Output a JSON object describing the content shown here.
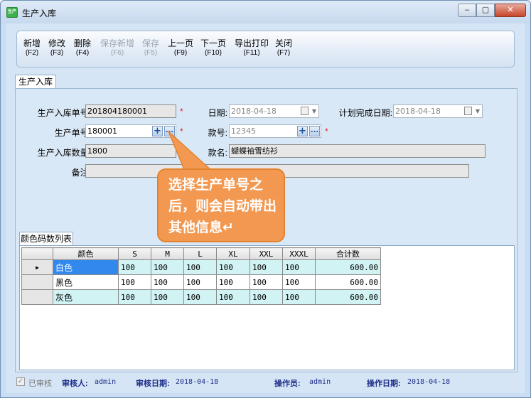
{
  "window": {
    "icon_text": "生产",
    "title": "生产入库",
    "controls": {
      "minimize": "–",
      "maximize": "▢",
      "close": "✕"
    }
  },
  "toolbar": [
    {
      "label": "新增",
      "key": "(F2)",
      "enabled": true
    },
    {
      "label": "修改",
      "key": "(F3)",
      "enabled": true
    },
    {
      "label": "删除",
      "key": "(F4)",
      "enabled": true
    },
    {
      "label": "保存新增",
      "key": "(F6)",
      "enabled": false
    },
    {
      "label": "保存",
      "key": "(F5)",
      "enabled": false
    },
    {
      "label": "上一页",
      "key": "(F9)",
      "enabled": true
    },
    {
      "label": "下一页",
      "key": "(F10)",
      "enabled": true
    },
    {
      "label": "导出打印",
      "key": "(F11)",
      "enabled": true
    },
    {
      "label": "关闭",
      "key": "(F7)",
      "enabled": true
    }
  ],
  "main_tab": "生产入库",
  "form": {
    "inbound_no_label": "生产入库单号:",
    "inbound_no": "201804180001",
    "date_label": "日期:",
    "date": "2018-04-18",
    "plan_done_label": "计划完成日期:",
    "plan_done": "2018-04-18",
    "prod_no_label": "生产单号:",
    "prod_no": "180001",
    "style_no_label": "款号:",
    "style_no": "12345",
    "qty_label": "生产入库数量:",
    "qty": "1800",
    "style_name_label": "款名:",
    "style_name": "蝴蝶袖雪纺衫",
    "remark_label": "备注:",
    "remark": "",
    "required_mark": "*",
    "add_symbol": "+",
    "browse_symbol": "..."
  },
  "callout": {
    "text": "选择生产单号之后，则会自动带出其他信息↵"
  },
  "sub_tab": "颜色码数列表",
  "grid": {
    "headers": [
      "颜色",
      "S",
      "M",
      "L",
      "XL",
      "XXL",
      "XXXL",
      "合计数"
    ],
    "current_row_marker": "▶",
    "rows": [
      {
        "color": "白色",
        "s": "100",
        "m": "100",
        "l": "100",
        "xl": "100",
        "xxl": "100",
        "xxxl": "100",
        "total": "600.00"
      },
      {
        "color": "黑色",
        "s": "100",
        "m": "100",
        "l": "100",
        "xl": "100",
        "xxl": "100",
        "xxxl": "100",
        "total": "600.00"
      },
      {
        "color": "灰色",
        "s": "100",
        "m": "100",
        "l": "100",
        "xl": "100",
        "xxl": "100",
        "xxxl": "100",
        "total": "600.00"
      }
    ]
  },
  "status": {
    "approved_label": "已审核",
    "approved_check": "✓",
    "reviewer_label": "审核人:",
    "reviewer": "admin",
    "review_date_label": "审核日期:",
    "review_date": "2018-04-18",
    "operator_label": "操作员:",
    "operator": "admin",
    "op_date_label": "操作日期:",
    "op_date": "2018-04-18"
  }
}
